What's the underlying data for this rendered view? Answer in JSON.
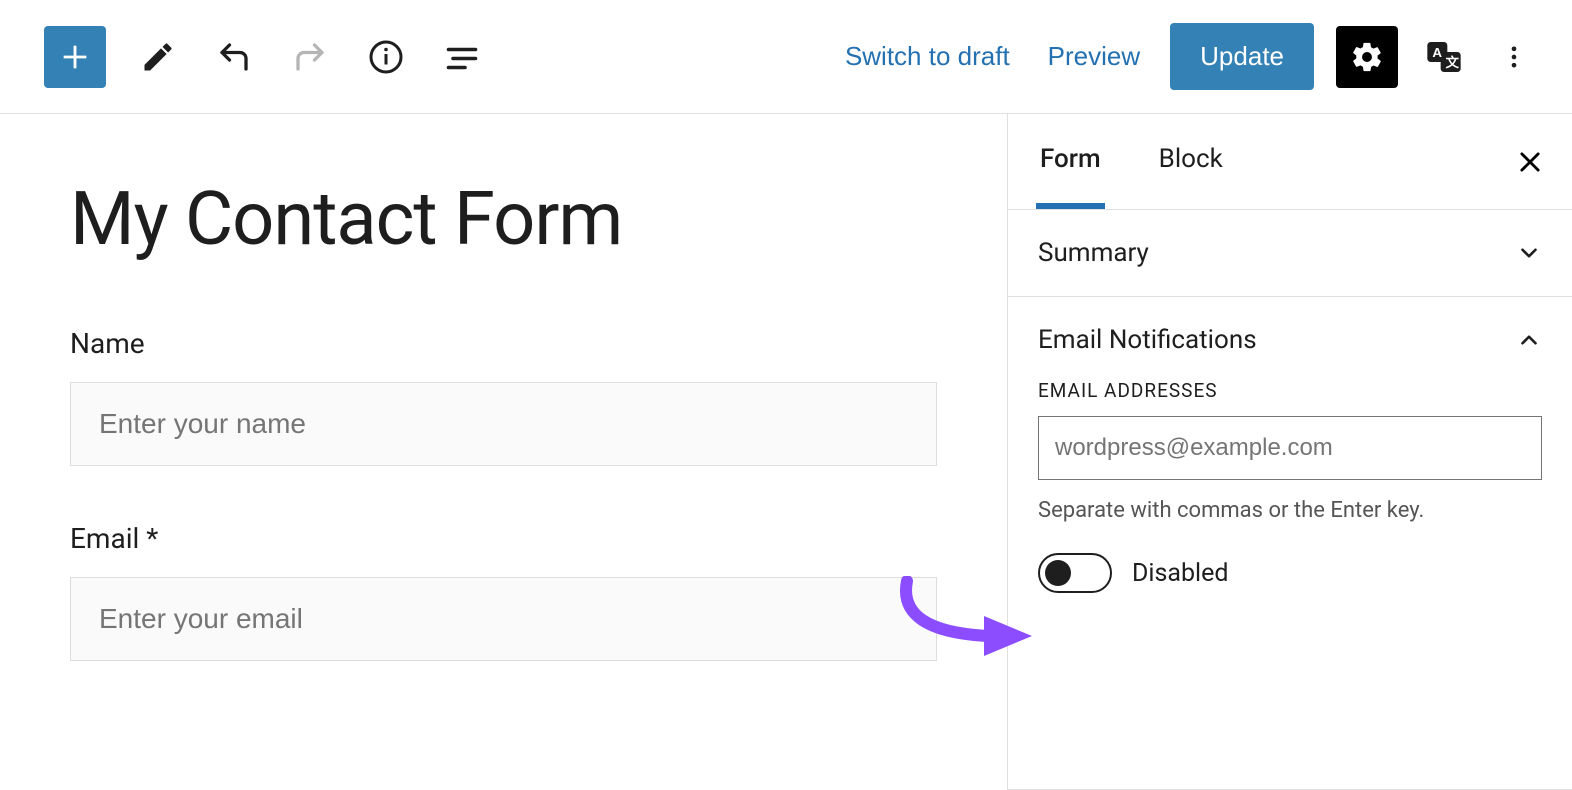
{
  "toolbar": {
    "switch_to_draft": "Switch to draft",
    "preview": "Preview",
    "update": "Update"
  },
  "canvas": {
    "title": "My Contact Form",
    "fields": [
      {
        "label": "Name",
        "placeholder": "Enter your name"
      },
      {
        "label": "Email *",
        "placeholder": "Enter your email"
      }
    ]
  },
  "sidebar": {
    "tabs": {
      "form": "Form",
      "block": "Block"
    },
    "panels": {
      "summary": {
        "title": "Summary"
      },
      "email_notifications": {
        "title": "Email Notifications",
        "sublabel": "EMAIL ADDRESSES",
        "email_placeholder": "wordpress@example.com",
        "help": "Separate with commas or the Enter key.",
        "toggle_label": "Disabled"
      }
    }
  }
}
